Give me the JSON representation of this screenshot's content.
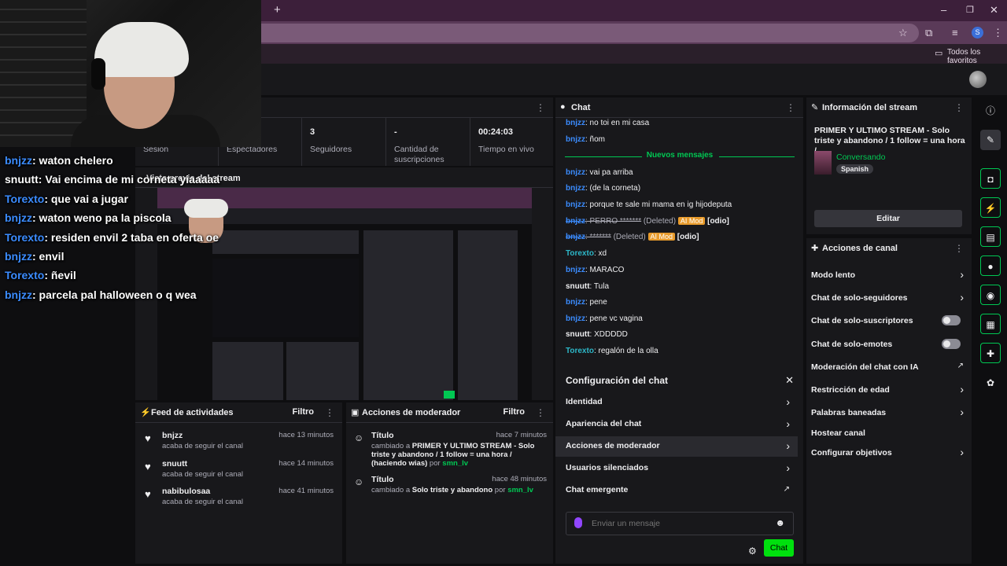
{
  "browser": {
    "new_tab": "+",
    "window_controls": {
      "minimize": "–",
      "maximize": "❐",
      "close": "✕"
    },
    "profile_initial": "S",
    "favorites_label": "Todos los favoritos",
    "icons": [
      "star-icon",
      "extension-icon",
      "media-icon",
      "kebab-icon",
      "folder-icon"
    ]
  },
  "overlay_chat": [
    {
      "user": "bnjzz",
      "text": ": waton chelero",
      "color": "#3b8cff"
    },
    {
      "user": "snuutt",
      "text": ": Vai encima de mi corneta yiaaaaa",
      "color": "#ffffff"
    },
    {
      "user": "Torexto",
      "text": ": que vai a jugar",
      "color": "#3b8cff"
    },
    {
      "user": "bnjzz",
      "text": ": waton weno pa la piscola",
      "color": "#3b8cff"
    },
    {
      "user": "Torexto",
      "text": ": residen envil 2 taba en oferta oe",
      "color": "#3b8cff"
    },
    {
      "user": "bnjzz",
      "text": ": envil",
      "color": "#3b8cff"
    },
    {
      "user": "Torexto",
      "text": ": ñevil",
      "color": "#3b8cff"
    },
    {
      "user": "bnjzz",
      "text": ": parcela pal halloween o q wea",
      "color": "#3b8cff"
    }
  ],
  "stats": [
    {
      "value": "",
      "label": "Sesión"
    },
    {
      "value": "",
      "label": "Espectadores"
    },
    {
      "value": "3",
      "label": "Seguidores"
    },
    {
      "value": "-",
      "label": "Cantidad de suscripciones"
    },
    {
      "value": "00:24:03",
      "label": "Tiempo en vivo"
    }
  ],
  "preview": {
    "title": "Vista previa del stream"
  },
  "feed": {
    "title": "Feed de actividades",
    "filter": "Filtro",
    "items": [
      {
        "user": "bnjzz",
        "sub": "acaba de seguir el canal",
        "time": "hace 13 minutos"
      },
      {
        "user": "snuutt",
        "sub": "acaba de seguir el canal",
        "time": "hace 14 minutos"
      },
      {
        "user": "nabibulosaa",
        "sub": "acaba de seguir el canal",
        "time": "hace 41 minutos"
      }
    ]
  },
  "mod": {
    "title": "Acciones de moderador",
    "filter": "Filtro",
    "items": [
      {
        "title": "Título",
        "time": "hace 7 minutos",
        "prefix": "cambiado a ",
        "value": "PRIMER Y ULTIMO STREAM - Solo triste y abandono / 1 follow = una hora / (haciendo wias)",
        "by": " por ",
        "user": "smn_lv"
      },
      {
        "title": "Título",
        "time": "hace 48 minutos",
        "prefix": "cambiado a ",
        "value": "Solo triste y abandono",
        "by": " por ",
        "user": "smn_lv"
      }
    ]
  },
  "chat": {
    "title": "Chat",
    "new_messages": "Nuevos mensajes",
    "before": [
      {
        "user": "bnjzz",
        "text": ": no toi en mi casa"
      },
      {
        "user": "bnjzz",
        "text": ": ñom"
      }
    ],
    "after": [
      {
        "user": "bnjzz",
        "text": ": vai pa arriba",
        "kind": "blue"
      },
      {
        "user": "bnjzz",
        "text": ": (de la corneta)",
        "kind": "blue"
      },
      {
        "user": "bnjzz",
        "text": ": porque te sale mi mama en ig hijodeputa",
        "kind": "blue"
      },
      {
        "user": "bnjzz",
        "text": ": PERRO *******",
        "kind": "deleted",
        "deleted": " (Deleted) ",
        "badge": "AI Mod",
        "tag": " [odio]"
      },
      {
        "user": "bnjzz",
        "text": ": *******",
        "kind": "deleted",
        "deleted": " (Deleted) ",
        "badge": "AI Mod",
        "tag": " [odio]"
      },
      {
        "user": "Torexto",
        "text": ": xd",
        "kind": "green"
      },
      {
        "user": "bnjzz",
        "text": ": MARACO",
        "kind": "blue"
      },
      {
        "user": "snuutt",
        "text": ": Tula",
        "kind": "white"
      },
      {
        "user": "bnjzz",
        "text": ": pene",
        "kind": "blue"
      },
      {
        "user": "bnjzz",
        "text": ": pene vc vagina",
        "kind": "blue"
      },
      {
        "user": "snuutt",
        "text": ": XDDDDD",
        "kind": "white"
      },
      {
        "user": "Torexto",
        "text": ": regalón de la olla",
        "kind": "green"
      }
    ],
    "config": {
      "title": "Configuración del chat",
      "items": [
        "Identidad",
        "Apariencia del chat",
        "Acciones de moderador",
        "Usuarios silenciados",
        "Chat emergente"
      ]
    },
    "input_placeholder": "Enviar un mensaje",
    "send_label": "Chat"
  },
  "stream_info": {
    "title": "Información del stream",
    "stream_title": "PRIMER Y ULTIMO STREAM - Solo triste y abandono / 1 follow = una hora /...",
    "category": "Conversando",
    "language": "Spanish",
    "edit_label": "Editar"
  },
  "channel_actions": {
    "title": "Acciones de canal",
    "items": [
      {
        "label": "Modo lento",
        "control": "arrow"
      },
      {
        "label": "Chat de solo-seguidores",
        "control": "arrow"
      },
      {
        "label": "Chat de solo-suscriptores",
        "control": "toggle",
        "on": false
      },
      {
        "label": "Chat de solo-emotes",
        "control": "toggle",
        "on": false
      },
      {
        "label": "Moderación del chat con IA",
        "control": "external"
      },
      {
        "label": "Restricción de edad",
        "control": "arrow"
      },
      {
        "label": "Palabras baneadas",
        "control": "arrow"
      },
      {
        "label": "Hostear canal",
        "control": "none"
      },
      {
        "label": "Configurar objetivos",
        "control": "arrow"
      }
    ]
  },
  "colors": {
    "accent": "#00c853",
    "brand": "#9146ff",
    "user_blue": "#3b8cff"
  }
}
